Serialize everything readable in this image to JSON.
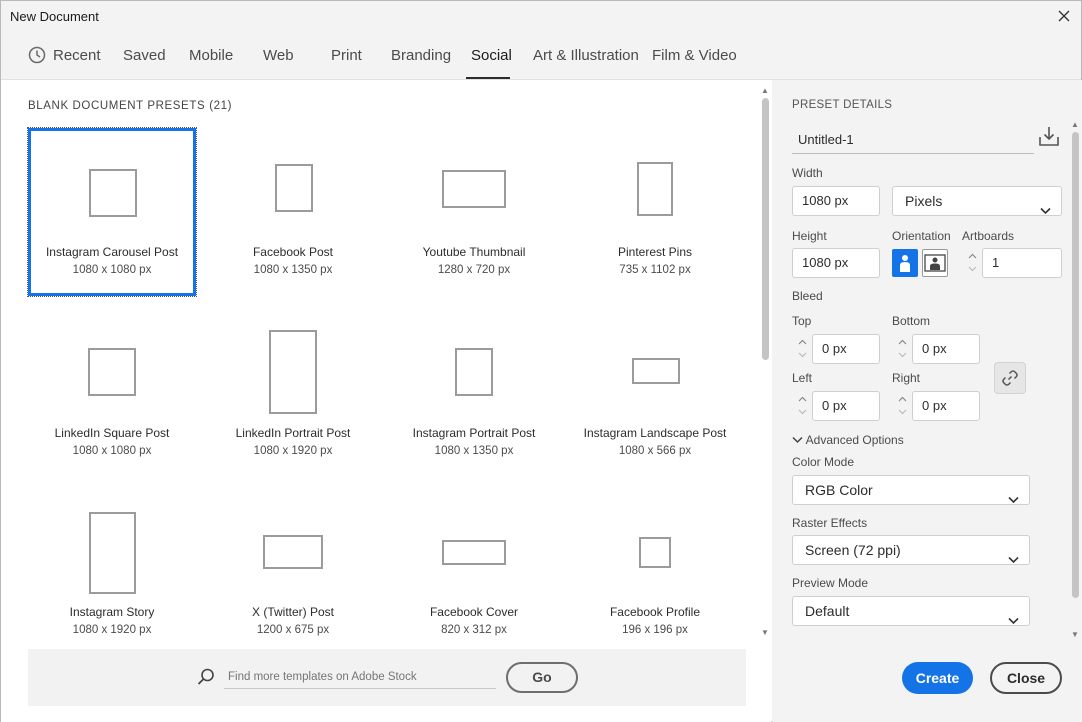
{
  "window": {
    "title": "New Document"
  },
  "tabs": [
    {
      "label": "Recent"
    },
    {
      "label": "Saved"
    },
    {
      "label": "Mobile"
    },
    {
      "label": "Web"
    },
    {
      "label": "Print"
    },
    {
      "label": "Branding"
    },
    {
      "label": "Social"
    },
    {
      "label": "Art & Illustration"
    },
    {
      "label": "Film & Video"
    }
  ],
  "active_tab": "Social",
  "presets_section": {
    "title": "BLANK DOCUMENT PRESETS",
    "count": "(21)"
  },
  "presets": [
    {
      "name": "Instagram Carousel Post",
      "dims": "1080 x 1080 px",
      "selected": true
    },
    {
      "name": "Facebook Post",
      "dims": "1080 x 1350 px"
    },
    {
      "name": "Youtube Thumbnail",
      "dims": "1280 x 720 px"
    },
    {
      "name": "Pinterest Pins",
      "dims": "735 x 1102 px"
    },
    {
      "name": "LinkedIn Square Post",
      "dims": "1080 x 1080 px"
    },
    {
      "name": "LinkedIn Portrait Post",
      "dims": "1080 x 1920 px"
    },
    {
      "name": "Instagram Portrait Post",
      "dims": "1080 x 1350 px"
    },
    {
      "name": "Instagram Landscape Post",
      "dims": "1080 x 566 px"
    },
    {
      "name": "Instagram Story",
      "dims": "1080 x 1920 px"
    },
    {
      "name": "X (Twitter) Post",
      "dims": "1200 x 675 px"
    },
    {
      "name": "Facebook Cover",
      "dims": "820 x 312 px"
    },
    {
      "name": "Facebook Profile",
      "dims": "196 x 196 px"
    }
  ],
  "stock": {
    "placeholder": "Find more templates on Adobe Stock",
    "go_label": "Go"
  },
  "details": {
    "header": "PRESET DETAILS",
    "doc_name": "Untitled-1",
    "width_label": "Width",
    "width_value": "1080 px",
    "units": "Pixels",
    "height_label": "Height",
    "height_value": "1080 px",
    "orientation_label": "Orientation",
    "orientation": "portrait",
    "artboards_label": "Artboards",
    "artboards_value": "1",
    "bleed_label": "Bleed",
    "top_label": "Top",
    "top_value": "0 px",
    "bottom_label": "Bottom",
    "bottom_value": "0 px",
    "left_label": "Left",
    "left_value": "0 px",
    "right_label": "Right",
    "right_value": "0 px",
    "advanced_label": "Advanced Options",
    "color_mode_label": "Color Mode",
    "color_mode_value": "RGB Color",
    "raster_label": "Raster Effects",
    "raster_value": "Screen (72 ppi)",
    "preview_label": "Preview Mode",
    "preview_value": "Default",
    "create_label": "Create",
    "close_label": "Close"
  },
  "colors": {
    "accent": "#1473e6",
    "panel": "#f3f3f3"
  }
}
